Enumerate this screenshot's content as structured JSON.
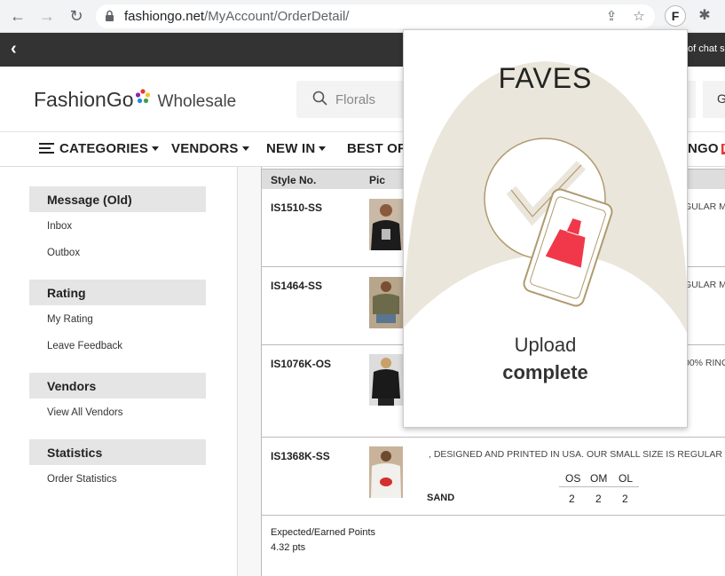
{
  "browser": {
    "url_host": "fashiongo.net",
    "url_path": "/MyAccount/OrderDetail/",
    "extension_letter": "F"
  },
  "topbar": {
    "chat_text": "of chat s"
  },
  "header": {
    "logo_text": "FashionGo",
    "logo_sub": "Wholesale",
    "search_placeholder": "Florals",
    "right_text": "G"
  },
  "nav": {
    "categories": "CATEGORIES",
    "vendors": "VENDORS",
    "new_in": "NEW IN",
    "best_of": "BEST OF",
    "ngo_fragment": "NGO",
    "ngo_badge": "L"
  },
  "sidebar": {
    "sections": [
      {
        "title": "Message (Old)",
        "links": [
          "Inbox",
          "Outbox"
        ]
      },
      {
        "title": "Rating",
        "links": [
          "My Rating",
          "Leave Feedback"
        ]
      },
      {
        "title": "Vendors",
        "links": [
          "View All Vendors"
        ]
      },
      {
        "title": "Statistics",
        "links": [
          "Order Statistics"
        ]
      }
    ]
  },
  "table": {
    "headers": {
      "style_no": "Style No.",
      "pic": "Pic"
    },
    "rows": [
      {
        "style_no": "IS1510-SS",
        "desc_fragment": "GULAR M"
      },
      {
        "style_no": "IS1464-SS",
        "desc_fragment": "GULAR M"
      },
      {
        "style_no": "IS1076K-OS",
        "desc_fragment": "00% RING"
      },
      {
        "style_no": "IS1368K-SS",
        "description": ", DESIGNED AND PRINTED IN USA. OUR SMALL SIZE IS REGULAR M",
        "sizes": [
          "OS",
          "OM",
          "OL"
        ],
        "color": "SAND",
        "quantities": [
          "2",
          "2",
          "2"
        ]
      }
    ],
    "points_label": "Expected/Earned Points",
    "points_value": "4.32 pts"
  },
  "popup": {
    "title": "FAVES",
    "status_line1": "Upload",
    "status_line2": "complete",
    "accent_color": "#f0384a",
    "bg_shape_color": "#ebe6dc"
  }
}
